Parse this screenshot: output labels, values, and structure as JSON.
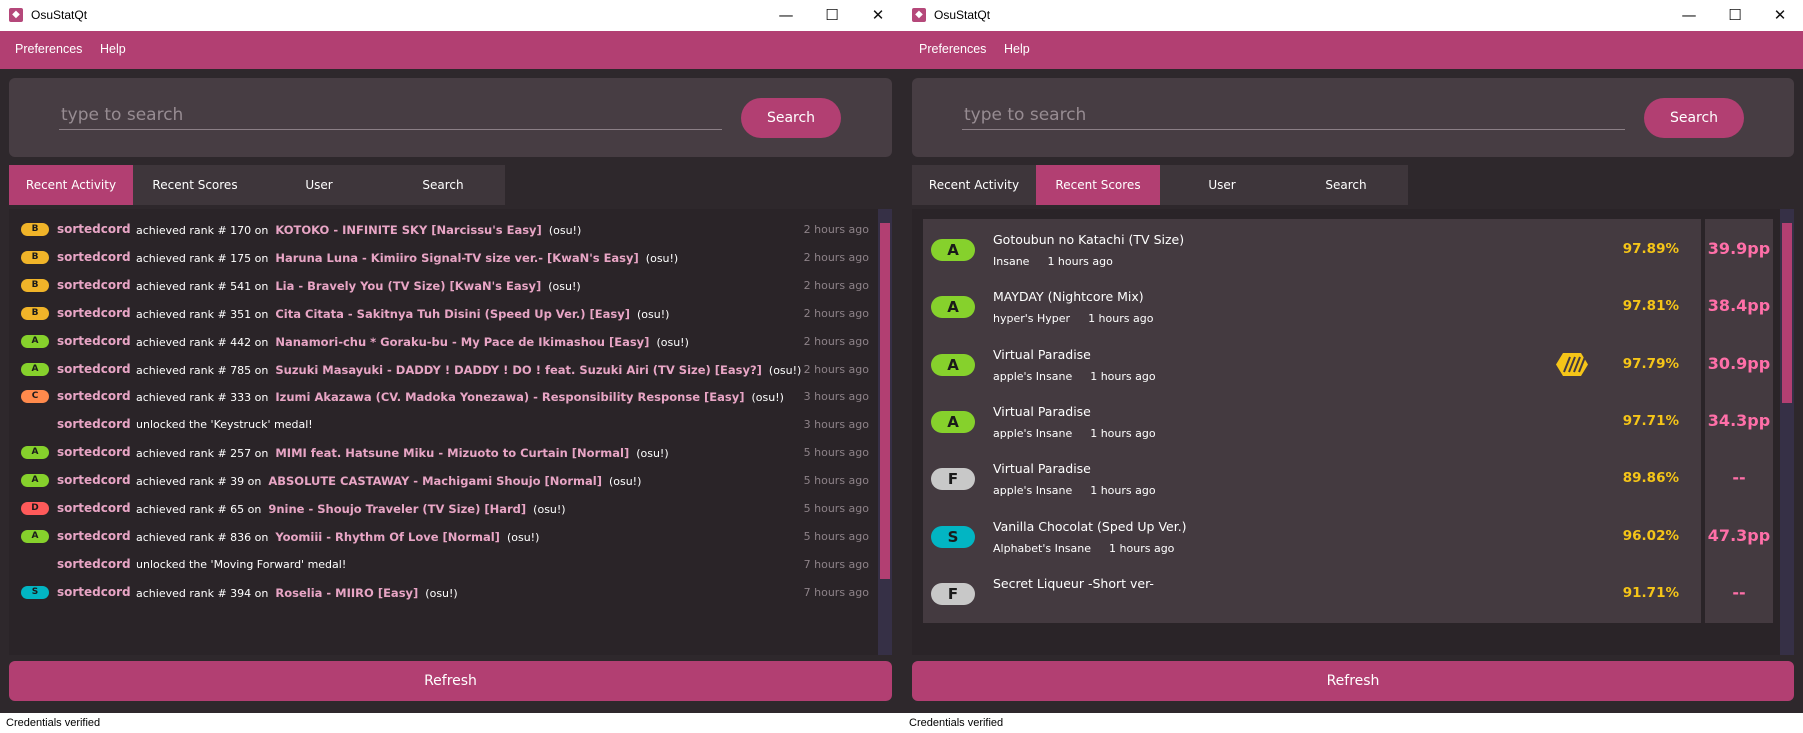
{
  "colors": {
    "accent": "#b23f72",
    "panel": "#473d43",
    "background": "#2e282c",
    "username": "#e8a5c5",
    "accuracy": "#f5c518",
    "pp": "#ff6fa8",
    "rank_B": "#f0b429",
    "rank_A": "#86d12c",
    "rank_C": "#ff8a4c",
    "rank_D": "#ff5a5a",
    "rank_S": "#02b5c3",
    "rank_F": "#c8c8c8"
  },
  "window": {
    "title": "OsuStatQt",
    "icon": "osu-app-icon",
    "controls": {
      "minimize": "—",
      "maximize": "☐",
      "close": "✕"
    }
  },
  "menu": {
    "preferences": "Preferences",
    "help": "Help"
  },
  "search": {
    "placeholder": "type to search",
    "button": "Search"
  },
  "tabs": [
    "Recent Activity",
    "Recent Scores",
    "User",
    "Search"
  ],
  "refresh": "Refresh",
  "status": "Credentials verified",
  "left_window": {
    "active_tab": "Recent Activity",
    "activity": [
      {
        "rank": "B",
        "user": "sortedcord",
        "text": "achieved rank # 170 on",
        "map": "KOTOKO - INFINITE SKY [Narcissu's Easy]",
        "mode": "(osu!)",
        "time": "2 hours ago"
      },
      {
        "rank": "B",
        "user": "sortedcord",
        "text": "achieved rank # 175 on",
        "map": "Haruna Luna - Kimiiro Signal-TV size ver.- [KwaN's Easy]",
        "mode": "(osu!)",
        "time": "2 hours ago"
      },
      {
        "rank": "B",
        "user": "sortedcord",
        "text": "achieved rank # 541 on",
        "map": "Lia - Bravely You (TV Size) [KwaN's Easy]",
        "mode": "(osu!)",
        "time": "2 hours ago"
      },
      {
        "rank": "B",
        "user": "sortedcord",
        "text": "achieved rank # 351 on",
        "map": "Cita Citata - Sakitnya Tuh Disini (Speed Up Ver.) [Easy]",
        "mode": "(osu!)",
        "time": "2 hours ago"
      },
      {
        "rank": "A",
        "user": "sortedcord",
        "text": "achieved rank # 442 on",
        "map": "Nanamori-chu * Goraku-bu - My Pace de Ikimashou [Easy]",
        "mode": "(osu!)",
        "time": "2 hours ago"
      },
      {
        "rank": "A",
        "user": "sortedcord",
        "text": "achieved rank # 785 on",
        "map": "Suzuki Masayuki - DADDY ! DADDY ! DO ! feat. Suzuki Airi (TV Size) [Easy?]",
        "mode": "(osu!)",
        "time": "2 hours ago"
      },
      {
        "rank": "C",
        "user": "sortedcord",
        "text": "achieved rank # 333 on",
        "map": "Izumi Akazawa (CV. Madoka Yonezawa) - Responsibility Response [Easy]",
        "mode": "(osu!)",
        "time": "3 hours ago"
      },
      {
        "rank": "",
        "user": "sortedcord",
        "text": "unlocked the 'Keystruck' medal!",
        "map": "",
        "mode": "",
        "time": "3 hours ago"
      },
      {
        "rank": "A",
        "user": "sortedcord",
        "text": "achieved rank # 257 on",
        "map": "MIMI feat. Hatsune Miku - Mizuoto to Curtain [Normal]",
        "mode": "(osu!)",
        "time": "5 hours ago"
      },
      {
        "rank": "A",
        "user": "sortedcord",
        "text": "achieved rank # 39 on",
        "map": "ABSOLUTE CASTAWAY - Machigami Shoujo [Normal]",
        "mode": "(osu!)",
        "time": "5 hours ago"
      },
      {
        "rank": "D",
        "user": "sortedcord",
        "text": "achieved rank # 65 on",
        "map": "9nine - Shoujo Traveler (TV Size) [Hard]",
        "mode": "(osu!)",
        "time": "5 hours ago"
      },
      {
        "rank": "A",
        "user": "sortedcord",
        "text": "achieved rank # 836 on",
        "map": "Yoomiii - Rhythm Of Love [Normal]",
        "mode": "(osu!)",
        "time": "5 hours ago"
      },
      {
        "rank": "",
        "user": "sortedcord",
        "text": "unlocked the 'Moving Forward' medal!",
        "map": "",
        "mode": "",
        "time": "7 hours ago"
      },
      {
        "rank": "S",
        "user": "sortedcord",
        "text": "achieved rank # 394 on",
        "map": "Roselia - MIIRO [Easy]",
        "mode": "(osu!)",
        "time": "7 hours ago"
      }
    ]
  },
  "right_window": {
    "active_tab": "Recent Scores",
    "scores": [
      {
        "rank": "A",
        "title": "Gotoubun no Katachi (TV Size)",
        "difficulty": "Insane",
        "time": "1 hours ago",
        "accuracy": "97.89%",
        "pp": "39.9pp",
        "mod": ""
      },
      {
        "rank": "A",
        "title": "MAYDAY (Nightcore Mix)",
        "difficulty": "hyper's Hyper",
        "time": "1 hours ago",
        "accuracy": "97.81%",
        "pp": "38.4pp",
        "mod": ""
      },
      {
        "rank": "A",
        "title": "Virtual Paradise",
        "difficulty": "apple's Insane",
        "time": "1 hours ago",
        "accuracy": "97.79%",
        "pp": "30.9pp",
        "mod": "double-time-mod-icon"
      },
      {
        "rank": "A",
        "title": "Virtual Paradise",
        "difficulty": "apple's Insane",
        "time": "1 hours ago",
        "accuracy": "97.71%",
        "pp": "34.3pp",
        "mod": ""
      },
      {
        "rank": "F",
        "title": "Virtual Paradise",
        "difficulty": "apple's Insane",
        "time": "1 hours ago",
        "accuracy": "89.86%",
        "pp": "--",
        "mod": ""
      },
      {
        "rank": "S",
        "title": "Vanilla Chocolat (Sped Up Ver.)",
        "difficulty": "Alphabet's Insane",
        "time": "1 hours ago",
        "accuracy": "96.02%",
        "pp": "47.3pp",
        "mod": ""
      },
      {
        "rank": "F",
        "title": "Secret Liqueur -Short ver-",
        "difficulty": "",
        "time": "",
        "accuracy": "91.71%",
        "pp": "--",
        "mod": ""
      }
    ]
  }
}
